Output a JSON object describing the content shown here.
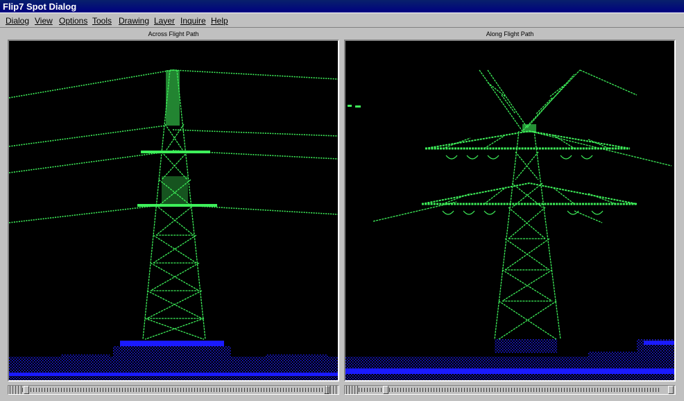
{
  "window": {
    "title": "Flip7 Spot Dialog"
  },
  "menu": {
    "items": [
      {
        "label": "Dialog"
      },
      {
        "label": "View"
      },
      {
        "label": "Options"
      },
      {
        "label": "Tools"
      },
      {
        "label": "Drawing"
      },
      {
        "label": "Layer"
      },
      {
        "label": "Inquire"
      },
      {
        "label": "Help"
      }
    ]
  },
  "views": {
    "left": {
      "label": "Across Flight Path"
    },
    "right": {
      "label": "Along Flight Path"
    }
  },
  "colors": {
    "point_structure": "#3ef05a",
    "point_ground": "#1a1aff",
    "viewport_bg": "#000000"
  }
}
